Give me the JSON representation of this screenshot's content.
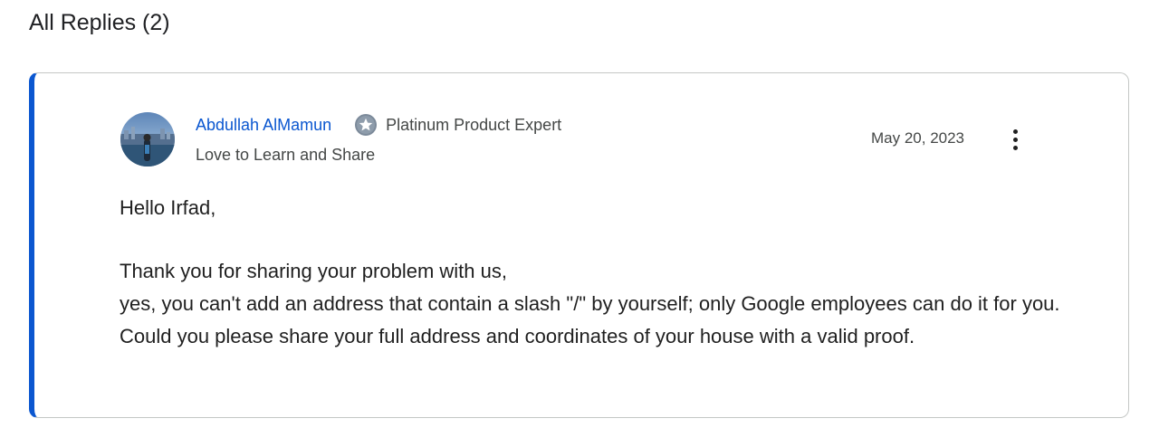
{
  "section": {
    "title": "All Replies (2)"
  },
  "reply": {
    "author": {
      "name": "Abdullah AlMamun",
      "badge_icon": "platinum-badge-icon",
      "badge_label": "Platinum Product Expert",
      "tagline": "Love to Learn and Share"
    },
    "date": "May 20, 2023",
    "menu_icon": "more-vert-icon",
    "body": {
      "greeting": "Hello Irfad,",
      "line1": "Thank you for sharing your problem with us,",
      "line2": "yes, you can't add an address that contain a slash \"/\" by yourself; only Google employees can do it for you. Could you please share your full address and coordinates of your house with a valid proof."
    }
  },
  "colors": {
    "accent": "#0b57d0",
    "card_border": "#c4c7c5",
    "secondary_text": "#444746"
  }
}
